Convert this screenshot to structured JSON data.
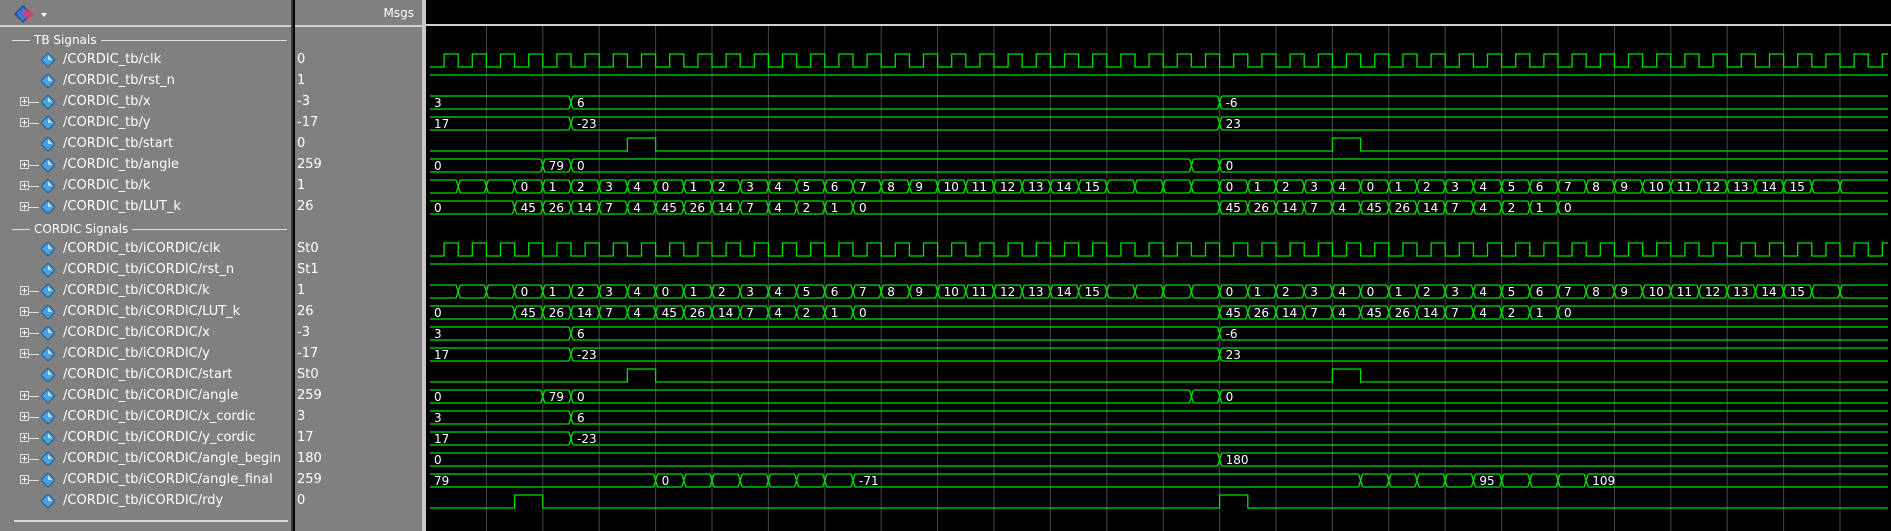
{
  "header": {
    "msgs_label": "Msgs"
  },
  "groups": [
    {
      "label": "TB Signals",
      "row": 0
    },
    {
      "label": "CORDIC Signals",
      "row": 9
    }
  ],
  "signals": [
    {
      "row": 1,
      "name": "/CORDIC_tb/clk",
      "value": "0",
      "expandable": false,
      "kind": "clock",
      "phase": 1
    },
    {
      "row": 2,
      "name": "/CORDIC_tb/rst_n",
      "value": "1",
      "expandable": false,
      "kind": "level",
      "level": 1
    },
    {
      "row": 3,
      "name": "/CORDIC_tb/x",
      "value": "-3",
      "expandable": true,
      "kind": "bus",
      "segments": [
        {
          "t": 0,
          "v": "3"
        },
        {
          "t": 5,
          "v": "6"
        },
        {
          "t": 28,
          "v": "-6"
        }
      ]
    },
    {
      "row": 4,
      "name": "/CORDIC_tb/y",
      "value": "-17",
      "expandable": true,
      "kind": "bus",
      "segments": [
        {
          "t": 0,
          "v": "17"
        },
        {
          "t": 5,
          "v": "-23"
        },
        {
          "t": 28,
          "v": "23"
        }
      ]
    },
    {
      "row": 5,
      "name": "/CORDIC_tb/start",
      "value": "0",
      "expandable": false,
      "kind": "pulse",
      "pulses": [
        [
          7,
          8
        ],
        [
          32,
          33
        ]
      ]
    },
    {
      "row": 6,
      "name": "/CORDIC_tb/angle",
      "value": "259",
      "expandable": true,
      "kind": "bus",
      "segments": [
        {
          "t": 0,
          "v": "0"
        },
        {
          "t": 4,
          "v": "79"
        },
        {
          "t": 5,
          "v": "0"
        },
        {
          "t": 27,
          "v": ""
        },
        {
          "t": 28,
          "v": "0"
        }
      ]
    },
    {
      "row": 7,
      "name": "/CORDIC_tb/k",
      "value": "1",
      "expandable": true,
      "kind": "bus",
      "segments": [
        {
          "t": 0,
          "v": ""
        },
        {
          "t": 1,
          "v": ""
        },
        {
          "t": 2,
          "v": ""
        },
        {
          "t": 3,
          "v": "0"
        },
        {
          "t": 4,
          "v": "1"
        },
        {
          "t": 5,
          "v": "2"
        },
        {
          "t": 6,
          "v": "3"
        },
        {
          "t": 7,
          "v": "4"
        },
        {
          "t": 8,
          "v": "0"
        },
        {
          "t": 9,
          "v": "1"
        },
        {
          "t": 10,
          "v": "2"
        },
        {
          "t": 11,
          "v": "3"
        },
        {
          "t": 12,
          "v": "4"
        },
        {
          "t": 13,
          "v": "5"
        },
        {
          "t": 14,
          "v": "6"
        },
        {
          "t": 15,
          "v": "7"
        },
        {
          "t": 16,
          "v": "8"
        },
        {
          "t": 17,
          "v": "9"
        },
        {
          "t": 18,
          "v": "10"
        },
        {
          "t": 19,
          "v": "11"
        },
        {
          "t": 20,
          "v": "12"
        },
        {
          "t": 21,
          "v": "13"
        },
        {
          "t": 22,
          "v": "14"
        },
        {
          "t": 23,
          "v": "15"
        },
        {
          "t": 24,
          "v": ""
        },
        {
          "t": 25,
          "v": ""
        },
        {
          "t": 26,
          "v": ""
        },
        {
          "t": 27,
          "v": ""
        },
        {
          "t": 28,
          "v": "0"
        },
        {
          "t": 29,
          "v": "1"
        },
        {
          "t": 30,
          "v": "2"
        },
        {
          "t": 31,
          "v": "3"
        },
        {
          "t": 32,
          "v": "4"
        },
        {
          "t": 33,
          "v": "0"
        },
        {
          "t": 34,
          "v": "1"
        },
        {
          "t": 35,
          "v": "2"
        },
        {
          "t": 36,
          "v": "3"
        },
        {
          "t": 37,
          "v": "4"
        },
        {
          "t": 38,
          "v": "5"
        },
        {
          "t": 39,
          "v": "6"
        },
        {
          "t": 40,
          "v": "7"
        },
        {
          "t": 41,
          "v": "8"
        },
        {
          "t": 42,
          "v": "9"
        },
        {
          "t": 43,
          "v": "10"
        },
        {
          "t": 44,
          "v": "11"
        },
        {
          "t": 45,
          "v": "12"
        },
        {
          "t": 46,
          "v": "13"
        },
        {
          "t": 47,
          "v": "14"
        },
        {
          "t": 48,
          "v": "15"
        },
        {
          "t": 49,
          "v": ""
        },
        {
          "t": 50,
          "v": ""
        }
      ]
    },
    {
      "row": 8,
      "name": "/CORDIC_tb/LUT_k",
      "value": "26",
      "expandable": true,
      "kind": "bus",
      "segments": [
        {
          "t": 0,
          "v": "0"
        },
        {
          "t": 3,
          "v": "45"
        },
        {
          "t": 4,
          "v": "26"
        },
        {
          "t": 5,
          "v": "14"
        },
        {
          "t": 6,
          "v": "7"
        },
        {
          "t": 7,
          "v": "4"
        },
        {
          "t": 8,
          "v": "45"
        },
        {
          "t": 9,
          "v": "26"
        },
        {
          "t": 10,
          "v": "14"
        },
        {
          "t": 11,
          "v": "7"
        },
        {
          "t": 12,
          "v": "4"
        },
        {
          "t": 13,
          "v": "2"
        },
        {
          "t": 14,
          "v": "1"
        },
        {
          "t": 15,
          "v": "0"
        },
        {
          "t": 28,
          "v": "45"
        },
        {
          "t": 29,
          "v": "26"
        },
        {
          "t": 30,
          "v": "14"
        },
        {
          "t": 31,
          "v": "7"
        },
        {
          "t": 32,
          "v": "4"
        },
        {
          "t": 33,
          "v": "45"
        },
        {
          "t": 34,
          "v": "26"
        },
        {
          "t": 35,
          "v": "14"
        },
        {
          "t": 36,
          "v": "7"
        },
        {
          "t": 37,
          "v": "4"
        },
        {
          "t": 38,
          "v": "2"
        },
        {
          "t": 39,
          "v": "1"
        },
        {
          "t": 40,
          "v": "0"
        }
      ]
    },
    {
      "row": 10,
      "name": "/CORDIC_tb/iCORDIC/clk",
      "value": "St0",
      "expandable": false,
      "kind": "clock",
      "phase": 1
    },
    {
      "row": 11,
      "name": "/CORDIC_tb/iCORDIC/rst_n",
      "value": "St1",
      "expandable": false,
      "kind": "level",
      "level": 1
    },
    {
      "row": 12,
      "name": "/CORDIC_tb/iCORDIC/k",
      "value": "1",
      "expandable": true,
      "kind": "ref",
      "ref": 7
    },
    {
      "row": 13,
      "name": "/CORDIC_tb/iCORDIC/LUT_k",
      "value": "26",
      "expandable": true,
      "kind": "ref",
      "ref": 8
    },
    {
      "row": 14,
      "name": "/CORDIC_tb/iCORDIC/x",
      "value": "-3",
      "expandable": true,
      "kind": "ref",
      "ref": 3
    },
    {
      "row": 15,
      "name": "/CORDIC_tb/iCORDIC/y",
      "value": "-17",
      "expandable": true,
      "kind": "ref",
      "ref": 4
    },
    {
      "row": 16,
      "name": "/CORDIC_tb/iCORDIC/start",
      "value": "St0",
      "expandable": false,
      "kind": "ref",
      "ref": 5
    },
    {
      "row": 17,
      "name": "/CORDIC_tb/iCORDIC/angle",
      "value": "259",
      "expandable": true,
      "kind": "ref",
      "ref": 6
    },
    {
      "row": 18,
      "name": "/CORDIC_tb/iCORDIC/x_cordic",
      "value": "3",
      "expandable": true,
      "kind": "bus",
      "segments": [
        {
          "t": 0,
          "v": "3"
        },
        {
          "t": 5,
          "v": "6"
        }
      ]
    },
    {
      "row": 19,
      "name": "/CORDIC_tb/iCORDIC/y_cordic",
      "value": "17",
      "expandable": true,
      "kind": "bus",
      "segments": [
        {
          "t": 0,
          "v": "17"
        },
        {
          "t": 5,
          "v": "-23"
        }
      ]
    },
    {
      "row": 20,
      "name": "/CORDIC_tb/iCORDIC/angle_begin",
      "value": "180",
      "expandable": true,
      "kind": "bus",
      "segments": [
        {
          "t": 0,
          "v": "0"
        },
        {
          "t": 28,
          "v": "180"
        }
      ]
    },
    {
      "row": 21,
      "name": "/CORDIC_tb/iCORDIC/angle_final",
      "value": "259",
      "expandable": true,
      "kind": "bus",
      "segments": [
        {
          "t": 0,
          "v": "79"
        },
        {
          "t": 8,
          "v": "0"
        },
        {
          "t": 9,
          "v": ""
        },
        {
          "t": 10,
          "v": ""
        },
        {
          "t": 11,
          "v": ""
        },
        {
          "t": 12,
          "v": ""
        },
        {
          "t": 13,
          "v": ""
        },
        {
          "t": 14,
          "v": ""
        },
        {
          "t": 15,
          "v": "-71"
        },
        {
          "t": 33,
          "v": ""
        },
        {
          "t": 34,
          "v": ""
        },
        {
          "t": 35,
          "v": ""
        },
        {
          "t": 36,
          "v": ""
        },
        {
          "t": 37,
          "v": "95"
        },
        {
          "t": 38,
          "v": ""
        },
        {
          "t": 39,
          "v": ""
        },
        {
          "t": 40,
          "v": ""
        },
        {
          "t": 41,
          "v": "109"
        }
      ]
    },
    {
      "row": 22,
      "name": "/CORDIC_tb/iCORDIC/rdy",
      "value": "0",
      "expandable": false,
      "kind": "pulse",
      "pulses": [
        [
          3,
          4
        ],
        [
          28,
          29
        ]
      ]
    }
  ],
  "colors": {
    "wave": "#00e000",
    "text": "#ffffff",
    "grid": "#4a4a4a",
    "pane": "#808080",
    "icon": "#4aa3e0"
  }
}
